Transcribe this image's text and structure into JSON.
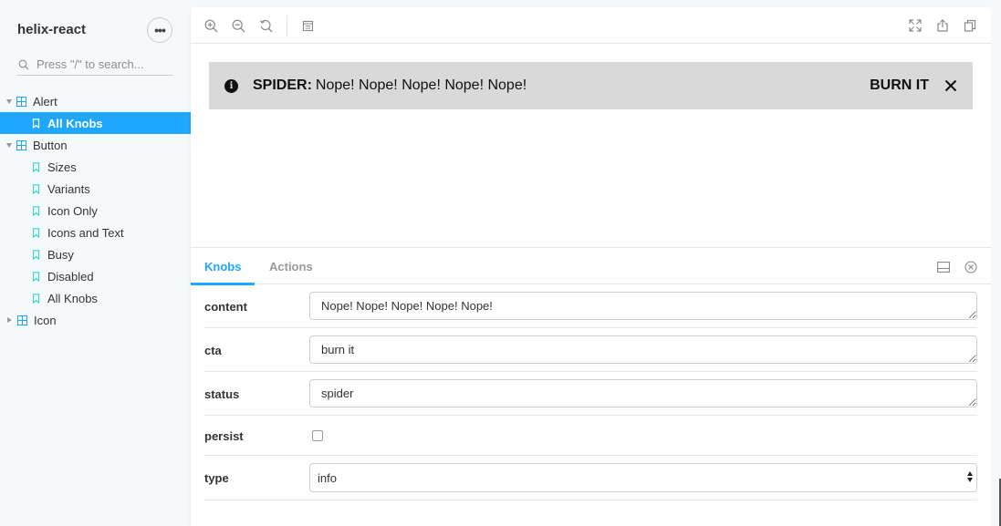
{
  "sidebar": {
    "brand": "helix-react",
    "menu_label": "•••",
    "search_placeholder": "Press \"/\" to search...",
    "tree": [
      {
        "type": "group",
        "label": "Alert",
        "expanded": true
      },
      {
        "type": "leaf",
        "label": "All Knobs",
        "selected": true
      },
      {
        "type": "group",
        "label": "Button",
        "expanded": true
      },
      {
        "type": "leaf",
        "label": "Sizes"
      },
      {
        "type": "leaf",
        "label": "Variants"
      },
      {
        "type": "leaf",
        "label": "Icon Only"
      },
      {
        "type": "leaf",
        "label": "Icons and Text"
      },
      {
        "type": "leaf",
        "label": "Busy"
      },
      {
        "type": "leaf",
        "label": "Disabled"
      },
      {
        "type": "leaf",
        "label": "All Knobs"
      },
      {
        "type": "group",
        "label": "Icon",
        "expanded": false
      }
    ]
  },
  "toolbar": {
    "icons": [
      "zoom-in-icon",
      "zoom-out-icon",
      "reset-zoom-icon",
      "background-icon",
      "fullscreen-icon",
      "share-icon",
      "copy-icon"
    ]
  },
  "alert": {
    "status": "SPIDER:",
    "content": "Nope! Nope! Nope! Nope! Nope!",
    "cta": "BURN IT",
    "close_glyph": "✕",
    "info_glyph": "i",
    "background": "#d9d9d9"
  },
  "panel": {
    "tabs": [
      {
        "label": "Knobs",
        "active": true
      },
      {
        "label": "Actions",
        "active": false
      }
    ],
    "knobs": {
      "content": {
        "label": "content",
        "value": "Nope! Nope! Nope! Nope! Nope!"
      },
      "cta": {
        "label": "cta",
        "value": "burn it"
      },
      "status": {
        "label": "status",
        "value": "spider"
      },
      "persist": {
        "label": "persist",
        "checked": false
      },
      "type": {
        "label": "type",
        "value": "info"
      }
    }
  },
  "colors": {
    "accent": "#1ea7fd",
    "sidebar_bg": "#f6f9fc",
    "tree_icon": "#1ea7fd"
  }
}
